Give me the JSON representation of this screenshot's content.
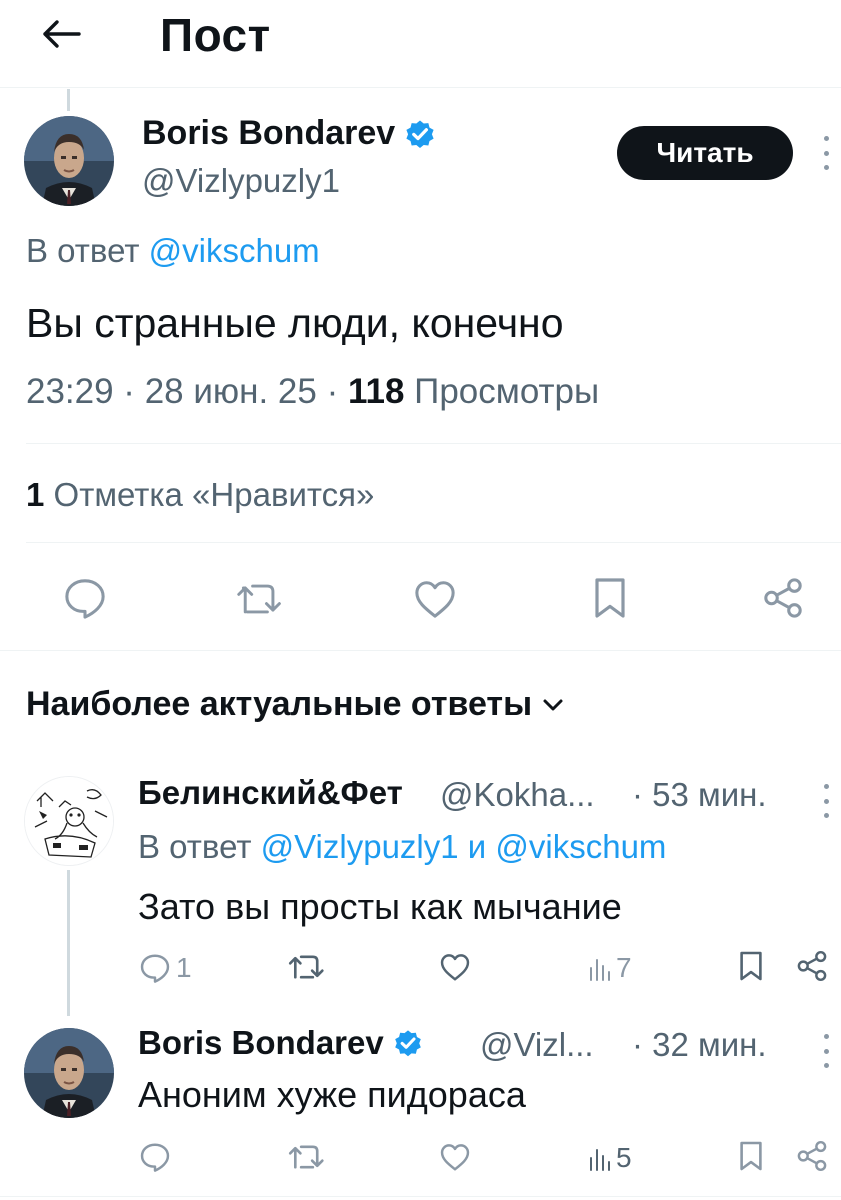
{
  "header": {
    "title": "Пост",
    "back_icon": "arrow-left-icon"
  },
  "main_post": {
    "author_name": "Boris Bondarev",
    "handle": "@Vizlypuzly1",
    "read_button": "Читать",
    "reply_prefix": "В ответ",
    "reply_to": "@vikschum",
    "text": "Вы странные люди, конечно",
    "timestamp": "23:29 · 28 июн. 25 ·",
    "views_count": "118",
    "views_label": "Просмотры",
    "likes_count": "1",
    "likes_label": "Отметка «Нравится»"
  },
  "sort": {
    "label": "Наиболее актуальные ответы"
  },
  "replies": [
    {
      "author_name": "Белинский&Фет",
      "handle": "@Kokha...",
      "time": "· 53 мин.",
      "reply_prefix": "В ответ",
      "reply_to": "@Vizlypuzly1 и @vikschum",
      "text": "Зато вы просты как мычание",
      "reply_count": "1",
      "views_count": "7"
    },
    {
      "author_name": "Boris Bondarev",
      "handle": "@Vizl...",
      "time": "· 32 мин.",
      "text": "Аноним хуже пидораса",
      "views_count": "5"
    }
  ],
  "colors": {
    "accent": "#1d9bf0",
    "text": "#0f1419",
    "muted": "#536471",
    "icon": "#8b98a5",
    "divider": "#eff3f4"
  }
}
